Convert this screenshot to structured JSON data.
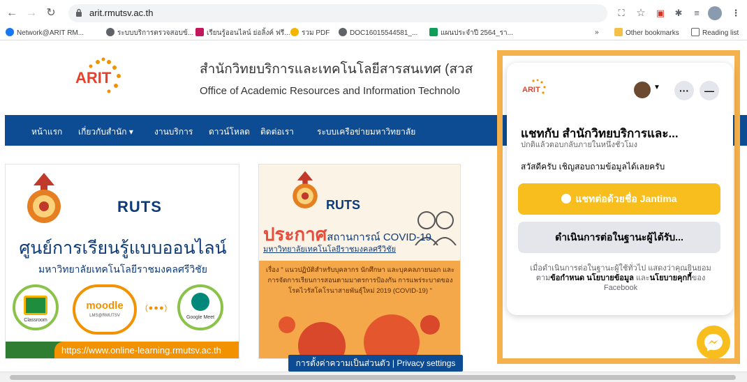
{
  "browser": {
    "url": "arit.rmutsv.ac.th",
    "bookmarks": [
      {
        "label": "Network@ARIT RM...",
        "color": "#1877f2"
      },
      {
        "label": "ระบบบริการตรวจสอบข้...",
        "color": "#5f6368"
      },
      {
        "label": "เรียนรู้ออนไลน์ ย่อลิ้งค์ ฟรี...",
        "color": "#c2185b"
      },
      {
        "label": "รวม PDF",
        "color": "#f4b400"
      },
      {
        "label": "DOC16015544581_...",
        "color": "#5f6368"
      },
      {
        "label": "แผนประจำปี 2564_รา...",
        "color": "#0f9d58"
      }
    ],
    "overflow_chevron": "»",
    "other_bookmarks": "Other bookmarks",
    "reading_list": "Reading list"
  },
  "site": {
    "logo_text": "ARIT",
    "title_th": "สำนักวิทยบริการและเทคโนโลยีสารสนเทศ (สวส",
    "title_en": "Office of Academic Resources and Information Technolo",
    "nav": [
      "หน้าแรก",
      "เกี่ยวกับสำนัก ▾",
      "งานบริการ",
      "ดาวน์โหลด",
      "ติดต่อเรา",
      "ระบบเครือข่ายมหาวิทยาลัย"
    ],
    "card1": {
      "brand": "RUTS",
      "heading": "ศูนย์การเรียนรู้แบบออนไลน์",
      "subheading": "มหาวิทยาลัยเทคโนโลยีราชมงคลศรีวิชัย",
      "tools": [
        "Classroom",
        "moodle",
        "Google Meet"
      ],
      "moodle_sub": "LMS@RMUTSV",
      "url": "https://www.online-learning.rmutsv.ac.th"
    },
    "card2": {
      "brand": "RUTS",
      "heading_big": "ประกาศ",
      "heading_rest": "สถานการณ์ COVID-19",
      "subheading": "มหาวิทยาลัยเทคโนโลยีราชมงคลศรีวิชัย",
      "body": "เรื่อง \" แนวปฏิบัติสำหรับบุคลากร นักศึกษา และบุคคลภายนอก และการจัดการเรียนการสอนตามมาตรการป้องกัน การแพร่ระบาดของโรคไวรัสโคโรนาสายพันธุ์ใหม่ 2019 (COVID-19) \""
    },
    "privacy_settings": "การตั้งค่าความเป็นส่วนตัว | Privacy settings"
  },
  "chat": {
    "title": "แชทกับ สำนักวิทยบริการและ...",
    "subtitle": "ปกติแล้วตอบกลับภายในหนึ่งชั่วโมง",
    "greeting": "สวัสดีครับ เชิญสอบถามข้อมูลได้เลยครับ",
    "continue_as_name": "แชทต่อด้วยชื่อ Jantima",
    "continue_as_guest": "ดำเนินการต่อในฐานะผู้ได้รับ...",
    "legal_prefix": "เมื่อดำเนินการต่อในฐานะผู้ใช้ทั่วไป แสดงว่าคุณยินยอมตาม",
    "legal_terms": "ข้อกำหนด",
    "legal_policy": "นโยบายข้อมูล",
    "legal_and": " และ",
    "legal_cookie": "นโยบายคุกกี้",
    "legal_suffix": "ของ Facebook",
    "more_label": "···",
    "minimize_label": "—"
  }
}
